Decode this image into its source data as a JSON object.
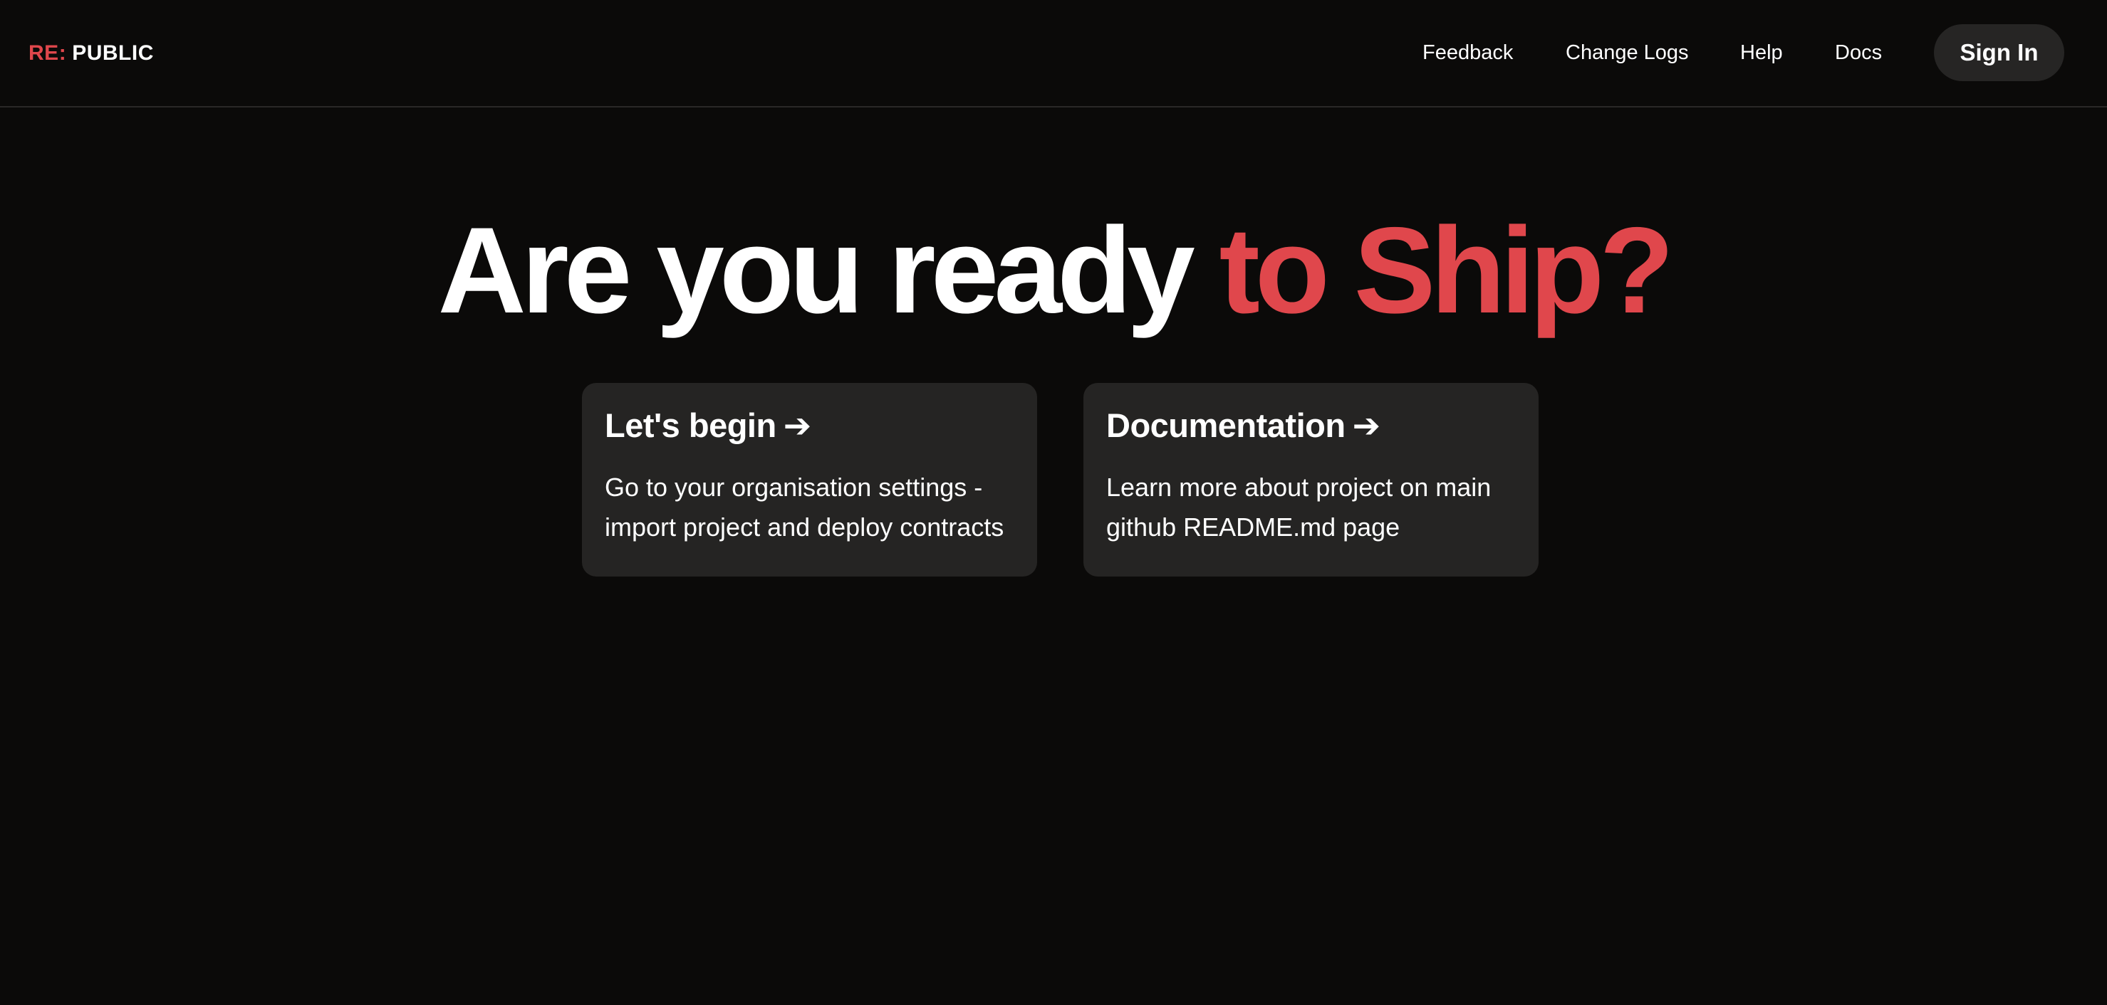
{
  "header": {
    "logo": {
      "prefix": "RE",
      "separator": ":",
      "name": "PUBLIC"
    },
    "nav": {
      "feedback": "Feedback",
      "change_logs": "Change Logs",
      "help": "Help",
      "docs": "Docs"
    },
    "sign_in_label": "Sign In"
  },
  "hero": {
    "title_white": "Are you ready",
    "title_accent": "to Ship?"
  },
  "cards": [
    {
      "title": "Let's begin",
      "arrow": "➔",
      "body": "Go to your organisation settings - import project and deploy contracts"
    },
    {
      "title": "Documentation",
      "arrow": "➔",
      "body": "Learn more about project on main github README.md page"
    }
  ],
  "colors": {
    "background": "#0b0a09",
    "accent": "#e0474c",
    "card": "#252423",
    "button": "#262524",
    "text": "#ffffff"
  }
}
